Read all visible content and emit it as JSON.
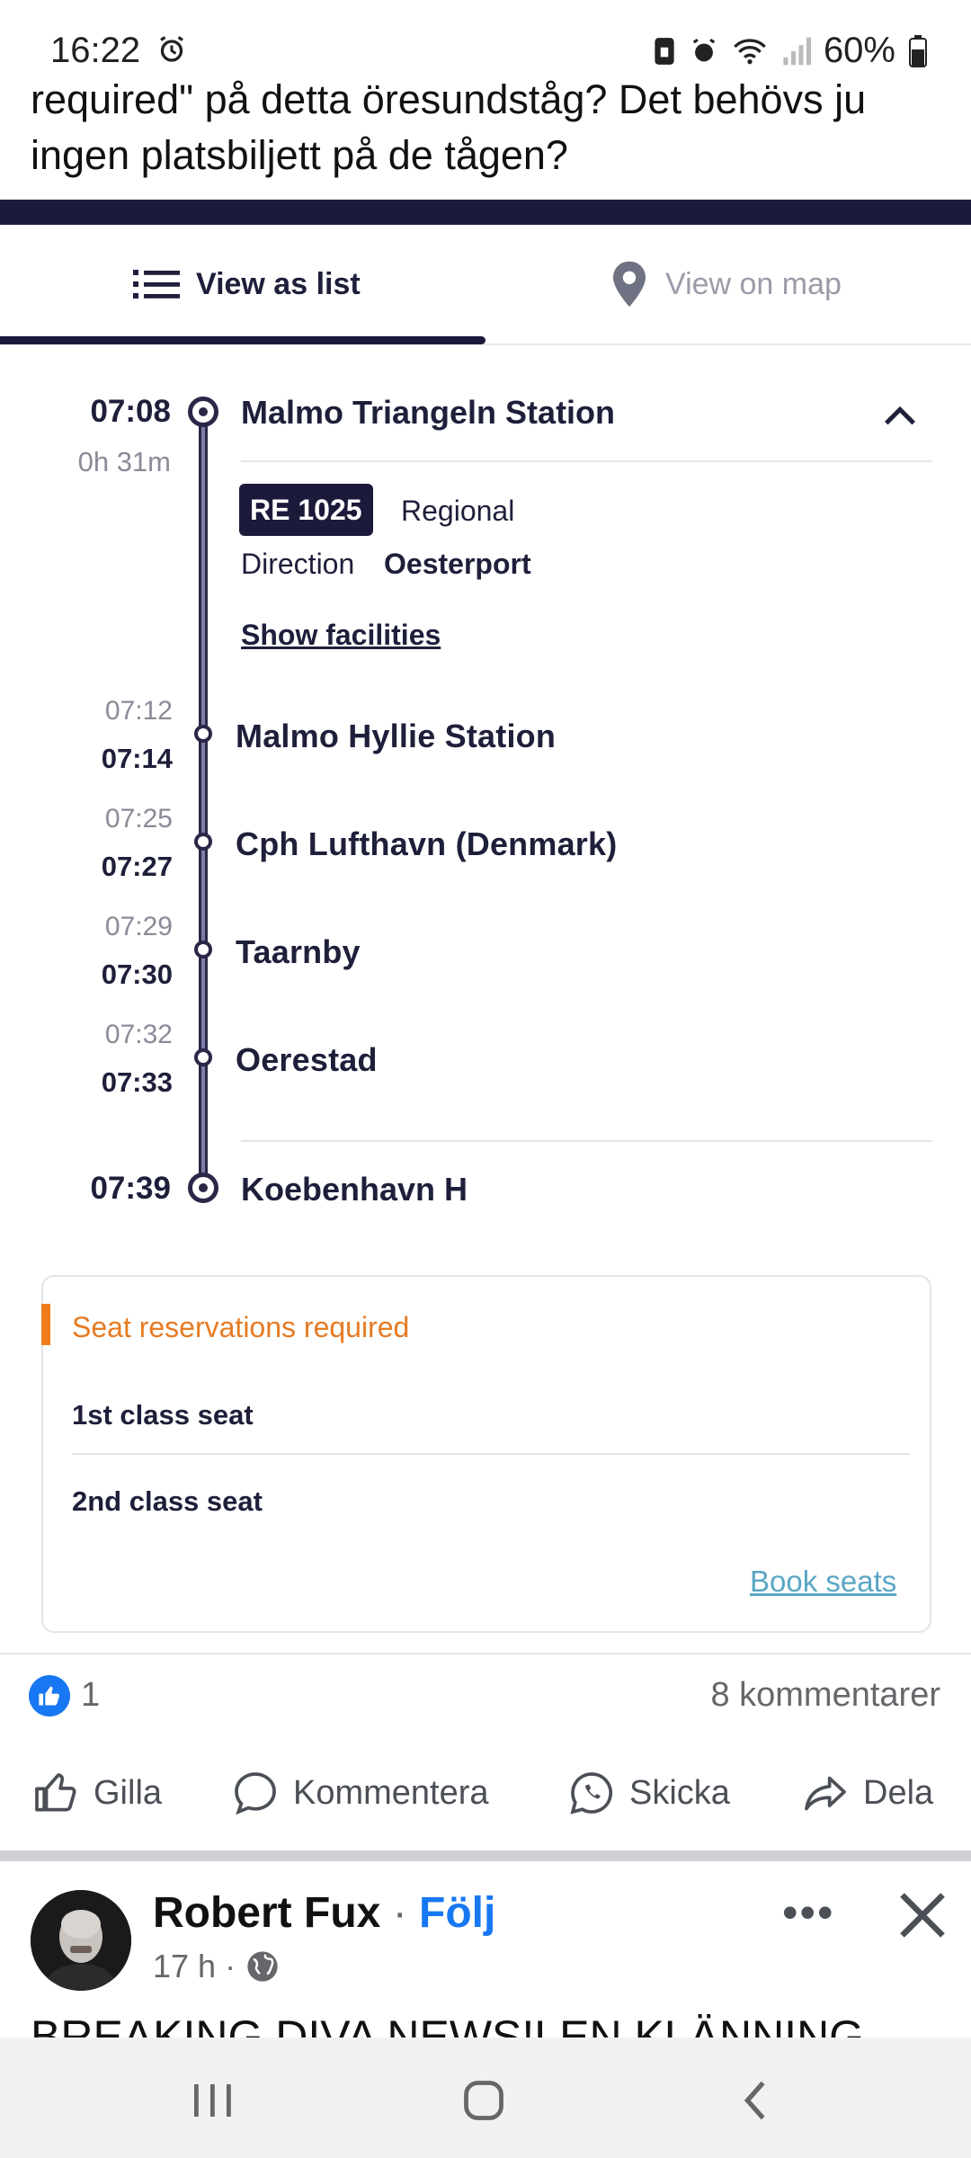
{
  "status_bar": {
    "time": "16:22",
    "battery": "60%"
  },
  "post": {
    "text": "required\" på detta öresundståg? Det behövs ju ingen platsbiljett på de tågen?"
  },
  "tabs": {
    "list_label": "View as list",
    "map_label": "View on map"
  },
  "journey": {
    "origin": {
      "time": "07:08",
      "duration": "0h 31m",
      "station": "Malmo Triangeln Station"
    },
    "train": {
      "badge": "RE 1025",
      "type": "Regional",
      "direction_label": "Direction",
      "direction": "Oesterport",
      "facilities_link": "Show facilities"
    },
    "stops": [
      {
        "arrival": "07:12",
        "departure": "07:14",
        "station": "Malmo Hyllie Station"
      },
      {
        "arrival": "07:25",
        "departure": "07:27",
        "station": "Cph Lufthavn (Denmark)"
      },
      {
        "arrival": "07:29",
        "departure": "07:30",
        "station": "Taarnby"
      },
      {
        "arrival": "07:32",
        "departure": "07:33",
        "station": "Oerestad"
      }
    ],
    "destination": {
      "time": "07:39",
      "station": "Koebenhavn H"
    }
  },
  "seats": {
    "title": "Seat reservations required",
    "first_class": "1st class seat",
    "second_class": "2nd class seat",
    "book_label": "Book seats"
  },
  "reactions": {
    "likes": "1",
    "comments": "8 kommentarer"
  },
  "actions": {
    "like": "Gilla",
    "comment": "Kommentera",
    "send": "Skicka",
    "share": "Dela"
  },
  "next_post": {
    "author": "Robert Fux",
    "follow": "Följ",
    "time": "17 h ·",
    "text": "BREAKING DIVA NEWS!LEN KLÄNNING"
  },
  "colors": {
    "accent_dark": "#1c1a3a",
    "warning": "#e67a22",
    "link": "#5aa6c4",
    "facebook_blue": "#1877f2"
  }
}
